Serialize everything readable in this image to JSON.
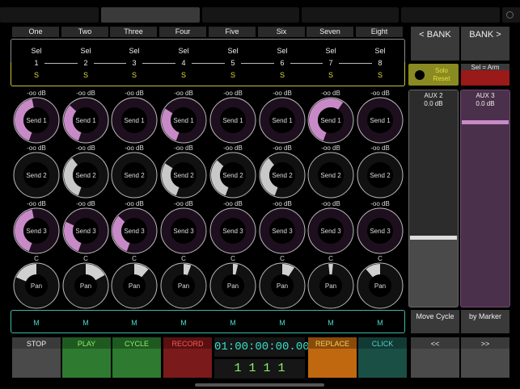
{
  "channels": [
    {
      "name": "One",
      "sel": "Sel",
      "num": "1",
      "solo": "S",
      "mute": "M",
      "send1_db": "-oo dB",
      "send2_db": "-oo dB",
      "send3_db": "-oo dB",
      "pan_label": "C",
      "send1": 0.55,
      "send2": 0.0,
      "send3": 0.55,
      "pan": -0.5
    },
    {
      "name": "Two",
      "sel": "Sel",
      "num": "2",
      "solo": "S",
      "mute": "M",
      "send1_db": "-oo dB",
      "send2_db": "-oo dB",
      "send3_db": "-oo dB",
      "pan_label": "C",
      "send1": 0.42,
      "send2": 0.45,
      "send3": 0.35,
      "pan": 0.45
    },
    {
      "name": "Three",
      "sel": "Sel",
      "num": "3",
      "solo": "S",
      "mute": "M",
      "send1_db": "-oo dB",
      "send2_db": "-oo dB",
      "send3_db": "-oo dB",
      "pan_label": "C",
      "send1": 0.0,
      "send2": 0.0,
      "send3": 0.42,
      "pan": 0.3
    },
    {
      "name": "Four",
      "sel": "Sel",
      "num": "4",
      "solo": "S",
      "mute": "M",
      "send1_db": "-oo dB",
      "send2_db": "-oo dB",
      "send3_db": "-oo dB",
      "pan_label": "C",
      "send1": 0.38,
      "send2": 0.38,
      "send3": 0.0,
      "pan": 0.15
    },
    {
      "name": "Five",
      "sel": "Sel",
      "num": "5",
      "solo": "S",
      "mute": "M",
      "send1_db": "-oo dB",
      "send2_db": "-oo dB",
      "send3_db": "-oo dB",
      "pan_label": "C",
      "send1": 0.0,
      "send2": 0.42,
      "send3": 0.0,
      "pan": 0.1
    },
    {
      "name": "Six",
      "sel": "Sel",
      "num": "6",
      "solo": "S",
      "mute": "M",
      "send1_db": "-oo dB",
      "send2_db": "-oo dB",
      "send3_db": "-oo dB",
      "pan_label": "C",
      "send1": 0.0,
      "send2": 0.45,
      "send3": 0.0,
      "pan": 0.25
    },
    {
      "name": "Seven",
      "sel": "Sel",
      "num": "7",
      "solo": "S",
      "mute": "M",
      "send1_db": "-oo dB",
      "send2_db": "-oo dB",
      "send3_db": "-oo dB",
      "pan_label": "C",
      "send1": 0.72,
      "send2": 0.0,
      "send3": 0.0,
      "pan": 0.0
    },
    {
      "name": "Eight",
      "sel": "Sel",
      "num": "8",
      "solo": "S",
      "mute": "M",
      "send1_db": "-oo dB",
      "send2_db": "-oo dB",
      "send3_db": "-oo dB",
      "pan_label": "C",
      "send1": 0.0,
      "send2": 0.0,
      "send3": 0.0,
      "pan": -0.3
    }
  ],
  "knob_labels": {
    "send1": "Send 1",
    "send2": "Send 2",
    "send3": "Send 3",
    "pan": "Pan"
  },
  "bank": {
    "prev": "< BANK",
    "next": "BANK >"
  },
  "solo_reset": {
    "line1": "Solo",
    "line2": "Reset"
  },
  "sel_arm": "Sel = Arm",
  "faders": [
    {
      "name": "AUX 2",
      "value": "0.0 dB",
      "level": 0.33
    },
    {
      "name": "AUX 3",
      "value": "0.0 dB",
      "level": 0.86
    }
  ],
  "move_cycle": "Move Cycle",
  "by_marker": "by Marker",
  "transport": {
    "stop": "STOP",
    "play": "PLAY",
    "cycle": "CYCLE",
    "record": "RECORD",
    "replace": "REPLACE",
    "click": "CLICK",
    "rewind": "<<",
    "forward": ">>",
    "timecode": "01:00:00:00.00",
    "bars": "1 1 1 1"
  },
  "colors": {
    "send1_fill": "#c78ac7",
    "send3_fill": "#c78ac7",
    "send2_fill": "#c8c8c8",
    "pan_fill": "#d0d0d0",
    "solo": "#e8df3a",
    "mute": "#4fd6cc",
    "play": "#2e7a30",
    "cycle": "#2e7a30",
    "record": "#7a1a1a",
    "replace": "#c06810",
    "click": "#1a4f46",
    "aux3": "#4a304a",
    "aux3_fill": "#c78ac7"
  }
}
